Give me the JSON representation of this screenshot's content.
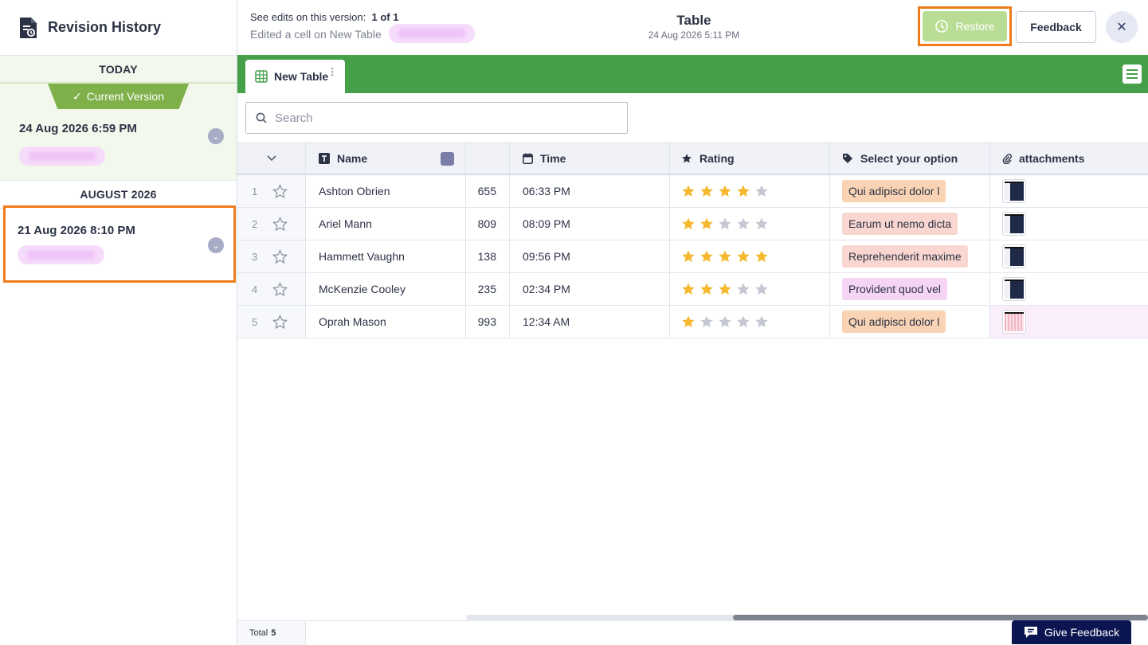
{
  "sidebar": {
    "title": "Revision History",
    "groups": [
      {
        "label": "TODAY",
        "revisions": [
          {
            "badge": "Current Version",
            "date": "24 Aug 2026 6:59 PM"
          }
        ]
      },
      {
        "label": "AUGUST 2026",
        "revisions": [
          {
            "date": "21 Aug 2026 8:10 PM"
          }
        ]
      }
    ]
  },
  "topbar": {
    "edits_label": "See edits on this version:",
    "edits_count": "1 of 1",
    "edited_text": "Edited a cell on New Table",
    "title": "Table",
    "subtitle": "24 Aug 2026 5:11 PM",
    "restore_label": "Restore",
    "feedback_label": "Feedback"
  },
  "tabs": [
    {
      "label": "New Table"
    }
  ],
  "search": {
    "placeholder": "Search"
  },
  "table": {
    "columns": [
      "Name",
      "",
      "Time",
      "Rating",
      "Select your option",
      "attachments"
    ],
    "rows": [
      {
        "num": "1",
        "name": "Ashton Obrien",
        "number": "655",
        "time": "06:33 PM",
        "rating": 4,
        "option": "Qui adipisci dolor l"
      },
      {
        "num": "2",
        "name": "Ariel Mann",
        "number": "809",
        "time": "08:09 PM",
        "rating": 2,
        "option": "Earum ut nemo dicta"
      },
      {
        "num": "3",
        "name": "Hammett Vaughn",
        "number": "138",
        "time": "09:56 PM",
        "rating": 5,
        "option": "Reprehenderit maxime"
      },
      {
        "num": "4",
        "name": "McKenzie Cooley",
        "number": "235",
        "time": "02:34 PM",
        "rating": 3,
        "option": "Provident quod vel"
      },
      {
        "num": "5",
        "name": "Oprah Mason",
        "number": "993",
        "time": "12:34 AM",
        "rating": 1,
        "option": "Qui adipisci dolor l"
      }
    ],
    "max_rating": 5
  },
  "colors": {
    "accent_green": "#46a049",
    "highlight_orange": "#ef7c1a",
    "star_filled": "#f5b82e",
    "star_empty": "#c5c7d2",
    "option_orange": "#f9d3b4",
    "option_red": "#f9d6cf",
    "option_pink": "#f6d4f4"
  },
  "footer": {
    "total_label": "Total",
    "total_value": "5",
    "give_feedback_label": "Give Feedback"
  }
}
